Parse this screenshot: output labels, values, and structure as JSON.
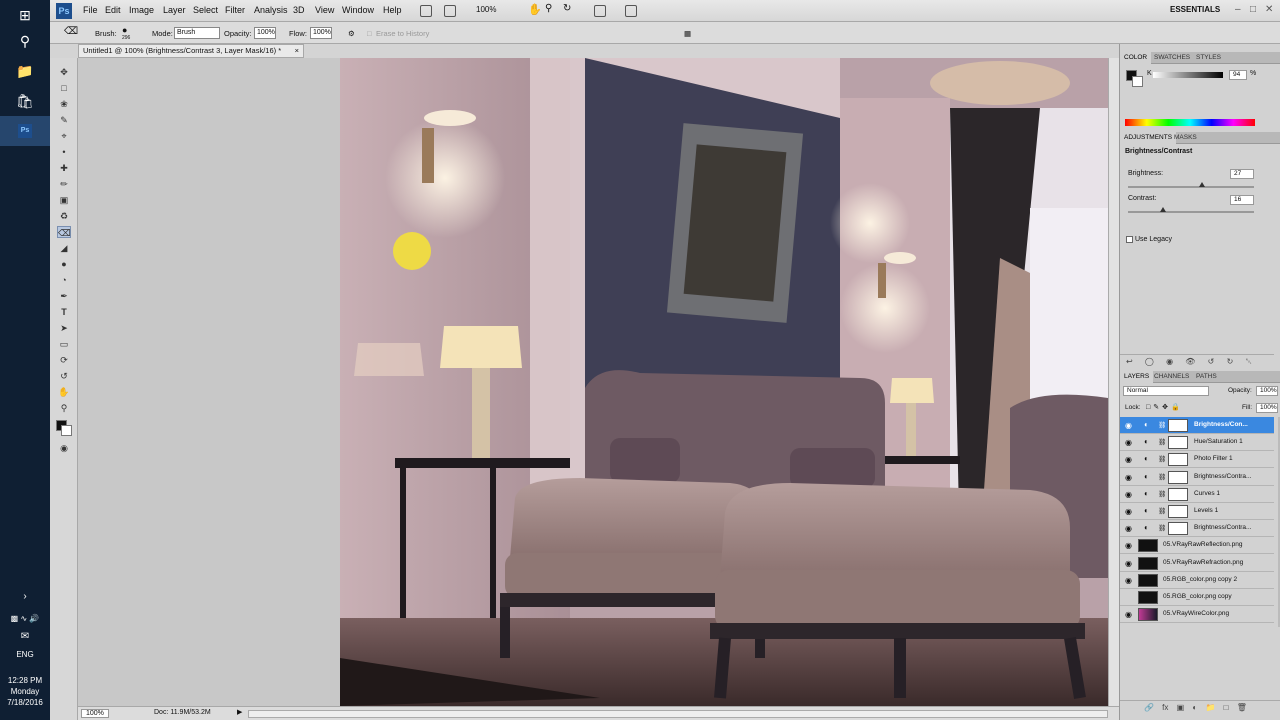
{
  "taskbar": {
    "lang": "ENG",
    "time": "12:28 PM",
    "day": "Monday",
    "date": "7/18/2016"
  },
  "menubar": {
    "logo": "Ps",
    "items": [
      "File",
      "Edit",
      "Image",
      "Layer",
      "Select",
      "Filter",
      "Analysis",
      "3D",
      "View",
      "Window",
      "Help"
    ],
    "zoom": "100%",
    "workspace": "ESSENTIALS"
  },
  "options": {
    "brush_label": "Brush:",
    "brush_size": "296",
    "mode_label": "Mode:",
    "mode_value": "Brush",
    "opacity_label": "Opacity:",
    "opacity_value": "100%",
    "flow_label": "Flow:",
    "flow_value": "100%",
    "erase_history": "Erase to History"
  },
  "document": {
    "tab_title": "Untitled1 @ 100% (Brightness/Contrast 3, Layer Mask/16) *",
    "zoom": "100%",
    "doc_info": "Doc: 11.9M/53.2M"
  },
  "color_panel": {
    "tabs": [
      "COLOR",
      "SWATCHES",
      "STYLES"
    ],
    "channel": "K",
    "value": "94",
    "unit": "%"
  },
  "adjustments_panel": {
    "tabs": [
      "ADJUSTMENTS",
      "MASKS"
    ],
    "title": "Brightness/Contrast",
    "brightness_label": "Brightness:",
    "brightness_value": "27",
    "brightness": 27,
    "contrast_label": "Contrast:",
    "contrast_value": "16",
    "contrast": 16,
    "legacy_label": "Use Legacy"
  },
  "layers_panel": {
    "tabs": [
      "LAYERS",
      "CHANNELS",
      "PATHS"
    ],
    "blend_mode": "Normal",
    "opacity_label": "Opacity:",
    "opacity_value": "100%",
    "lock_label": "Lock:",
    "fill_label": "Fill:",
    "fill_value": "100%",
    "layers": [
      {
        "name": "Brightness/Con...",
        "type": "adjust",
        "selected": true
      },
      {
        "name": "Hue/Saturation 1",
        "type": "adjust",
        "selected": false
      },
      {
        "name": "Photo Filter 1",
        "type": "adjust",
        "selected": false
      },
      {
        "name": "Brightness/Contra...",
        "type": "adjust",
        "selected": false
      },
      {
        "name": "Curves 1",
        "type": "adjust",
        "selected": false
      },
      {
        "name": "Levels 1",
        "type": "adjust",
        "selected": false
      },
      {
        "name": "Brightness/Contra...",
        "type": "adjust",
        "selected": false
      },
      {
        "name": "05.VRayRawReflection.png",
        "type": "image",
        "selected": false
      },
      {
        "name": "05.VRayRawRefraction.png",
        "type": "image",
        "selected": false
      },
      {
        "name": "05.RGB_color.png copy 2",
        "type": "image",
        "selected": false
      },
      {
        "name": "05.RGB_color.png copy",
        "type": "image",
        "selected": false
      },
      {
        "name": "05.VRayWireColor.png",
        "type": "image",
        "selected": false
      }
    ]
  },
  "colors": {
    "taskbar": "#0f1f33",
    "ps_blue": "#1d4e8d",
    "selection": "#3a88e0",
    "wall_dark": "#3f3f55",
    "sofa": "#9b8185"
  }
}
